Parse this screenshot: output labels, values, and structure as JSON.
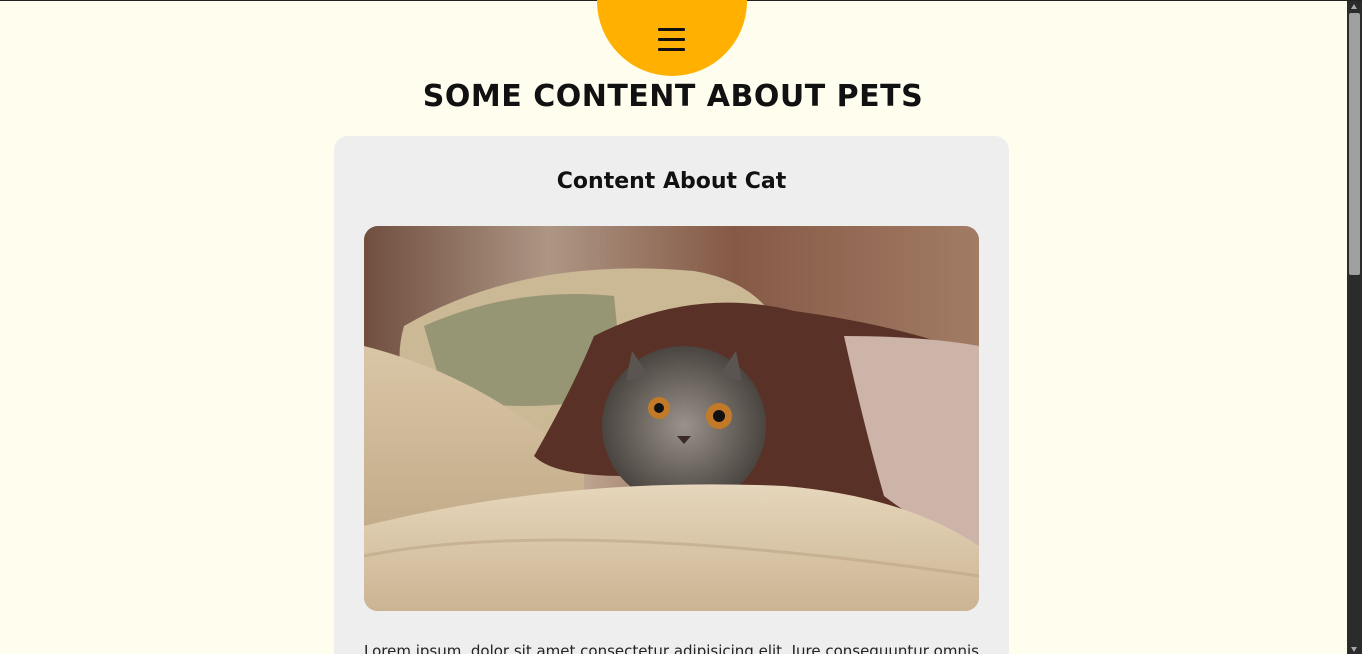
{
  "header": {
    "menu_icon": "hamburger-icon",
    "title": "SOME CONTENT ABOUT PETS",
    "accent_color": "#ffb000"
  },
  "card": {
    "title": "Content About Cat",
    "image_alt": "cat-under-blanket-image",
    "text": "Lorem ipsum, dolor sit amet consectetur adipisicing elit. Iure consequuntur omnis"
  },
  "colors": {
    "page_background": "#fffdee",
    "card_background": "#eeeeee"
  }
}
